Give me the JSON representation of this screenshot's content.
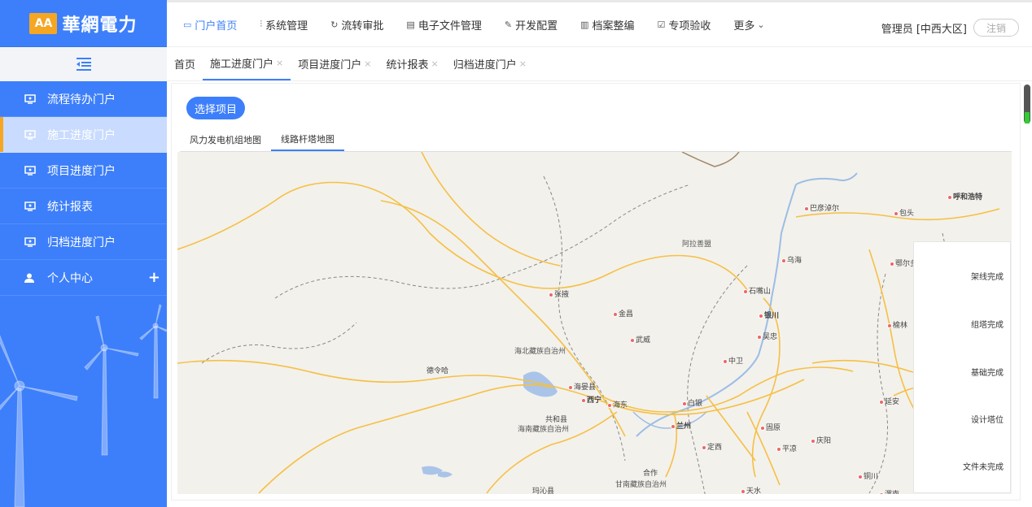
{
  "app": {
    "logo_text": "華網電力",
    "logo_mark": "AA"
  },
  "topnav": {
    "items": [
      {
        "label": "门户首页",
        "icon": "monitor-icon"
      },
      {
        "label": "系统管理",
        "icon": "sliders-icon"
      },
      {
        "label": "流转审批",
        "icon": "refresh-icon"
      },
      {
        "label": "电子文件管理",
        "icon": "file-icon"
      },
      {
        "label": "开发配置",
        "icon": "wrench-icon"
      },
      {
        "label": "档案整编",
        "icon": "barcode-icon"
      },
      {
        "label": "专项验收",
        "icon": "checkbox-icon"
      },
      {
        "label": "更多",
        "icon": "chevron-down-icon"
      }
    ],
    "user": "管理员 [中西大区]",
    "logout": "注销"
  },
  "tabs": [
    {
      "label": "首页",
      "closable": false
    },
    {
      "label": "施工进度门户",
      "closable": true
    },
    {
      "label": "项目进度门户",
      "closable": true
    },
    {
      "label": "统计报表",
      "closable": true
    },
    {
      "label": "归档进度门户",
      "closable": true
    }
  ],
  "sidebar": {
    "items": [
      {
        "label": "流程待办门户"
      },
      {
        "label": "施工进度门户"
      },
      {
        "label": "项目进度门户"
      },
      {
        "label": "统计报表"
      },
      {
        "label": "归档进度门户"
      },
      {
        "label": "个人中心"
      }
    ],
    "plus": "+"
  },
  "content": {
    "select_button": "选择项目",
    "subtabs": [
      "风力发电机组地图",
      "线路杆塔地图"
    ]
  },
  "map": {
    "labels": [
      "呼和浩特",
      "巴彦淖尔",
      "包头",
      "阿拉善盟",
      "乌海",
      "鄂尔多",
      "石嘴山",
      "张掖",
      "金昌",
      "银川",
      "吴忠",
      "榆林",
      "武威",
      "海北藏族自治州",
      "中卫",
      "德令哈",
      "海晏县",
      "西宁",
      "海东",
      "白银",
      "延安",
      "共和县",
      "海南藏族自治州",
      "兰州",
      "固原",
      "定西",
      "庆阳",
      "平凉",
      "合作",
      "甘南藏族自治州",
      "铜川",
      "玛沁县",
      "天水",
      "渭南"
    ]
  },
  "legend": [
    "架线完成",
    "组塔完成",
    "基础完成",
    "设计塔位",
    "文件未完成"
  ],
  "colors": {
    "primary": "#3d7ffa",
    "accent": "#f5a623"
  }
}
